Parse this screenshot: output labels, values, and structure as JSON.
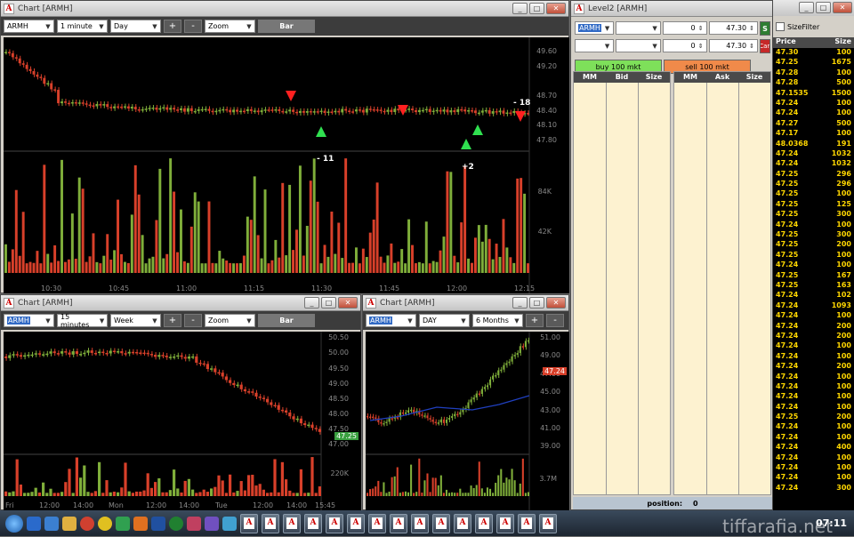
{
  "chart1": {
    "title": "Chart [ARMH]",
    "symbol": "ARMH",
    "interval": "1 minute",
    "range": "Day",
    "zoom": "Zoom",
    "plus": "+",
    "minus": "-",
    "bar_label": "Bar",
    "y_labels": [
      "49.60",
      "49.20",
      "48.70",
      "48.40",
      "48.10",
      "47.80"
    ],
    "vol_labels": [
      "84K",
      "42K"
    ],
    "x_labels": [
      "10:30",
      "10:45",
      "11:00",
      "11:15",
      "11:30",
      "11:45",
      "12:00",
      "12:15"
    ],
    "annotations": [
      "- 11",
      "+2",
      "- 18"
    ]
  },
  "chart2": {
    "title": "Chart [ARMH]",
    "symbol": "ARMH",
    "interval": "15 minutes",
    "range": "Week",
    "zoom": "Zoom",
    "plus": "+",
    "minus": "-",
    "bar_label": "Bar",
    "y_labels": [
      "50.50",
      "50.00",
      "49.50",
      "49.00",
      "48.50",
      "48.00",
      "47.50",
      "47.00"
    ],
    "price_tag": "47.25",
    "vol_label": "220K",
    "x_labels": [
      "Fri",
      "12:00",
      "14:00",
      "Mon",
      "12:00",
      "14:00",
      "Tue",
      "12:00",
      "14:00",
      "15:45"
    ]
  },
  "chart3": {
    "title": "Chart [ARMH]",
    "symbol": "ARMH",
    "interval": "DAY",
    "range": "6 Months",
    "plus": "+",
    "minus": "-",
    "y_labels": [
      "51.00",
      "49.00",
      "47.00",
      "45.00",
      "43.00",
      "41.00",
      "39.00"
    ],
    "price_tag": "47.24",
    "vol_label": "3.7M"
  },
  "level2": {
    "title": "Level2 [ARMH]",
    "symbol": "ARMH",
    "buy_qty": "0",
    "buy_price": "47.30",
    "sell_qty": "0",
    "sell_price": "47.30",
    "buy_button": "buy 100 mkt",
    "sell_button": "sell 100 mkt",
    "s_btn": "S",
    "can_btn": "Can",
    "bid_headers": [
      "MM",
      "Bid",
      "Size"
    ],
    "ask_headers": [
      "MM",
      "Ask",
      "Size"
    ],
    "position_label": "position:",
    "position_value": "0"
  },
  "tape": {
    "size_filter": "SizeFilter",
    "price_header": "Price",
    "size_header": "Size",
    "rows": [
      [
        "47.30",
        "100"
      ],
      [
        "47.25",
        "1675"
      ],
      [
        "47.28",
        "100"
      ],
      [
        "47.28",
        "500"
      ],
      [
        "47.1535",
        "1500"
      ],
      [
        "47.24",
        "100"
      ],
      [
        "47.24",
        "100"
      ],
      [
        "47.27",
        "500"
      ],
      [
        "47.17",
        "100"
      ],
      [
        "48.0368",
        "191"
      ],
      [
        "47.24",
        "1032"
      ],
      [
        "47.24",
        "1032"
      ],
      [
        "47.25",
        "296"
      ],
      [
        "47.25",
        "296"
      ],
      [
        "47.25",
        "100"
      ],
      [
        "47.25",
        "125"
      ],
      [
        "47.25",
        "300"
      ],
      [
        "47.24",
        "100"
      ],
      [
        "47.25",
        "300"
      ],
      [
        "47.25",
        "200"
      ],
      [
        "47.25",
        "100"
      ],
      [
        "47.24",
        "100"
      ],
      [
        "47.25",
        "167"
      ],
      [
        "47.25",
        "163"
      ],
      [
        "47.24",
        "102"
      ],
      [
        "47.24",
        "1093"
      ],
      [
        "47.24",
        "100"
      ],
      [
        "47.24",
        "200"
      ],
      [
        "47.24",
        "200"
      ],
      [
        "47.24",
        "100"
      ],
      [
        "47.24",
        "100"
      ],
      [
        "47.24",
        "200"
      ],
      [
        "47.24",
        "100"
      ],
      [
        "47.24",
        "100"
      ],
      [
        "47.24",
        "100"
      ],
      [
        "47.24",
        "100"
      ],
      [
        "47.25",
        "200"
      ],
      [
        "47.24",
        "100"
      ],
      [
        "47.24",
        "100"
      ],
      [
        "47.24",
        "400"
      ],
      [
        "47.24",
        "100"
      ],
      [
        "47.24",
        "100"
      ],
      [
        "47.24",
        "100"
      ],
      [
        "47.24",
        "300"
      ]
    ]
  },
  "taskbar": {
    "clock": "07:11"
  },
  "watermark": "tiffarafia.net",
  "colors": {
    "up": "#7fae3a",
    "down": "#d8402a",
    "buy": "#7ee05a",
    "sell": "#f08a4a",
    "tape_text": "#ffd700"
  }
}
